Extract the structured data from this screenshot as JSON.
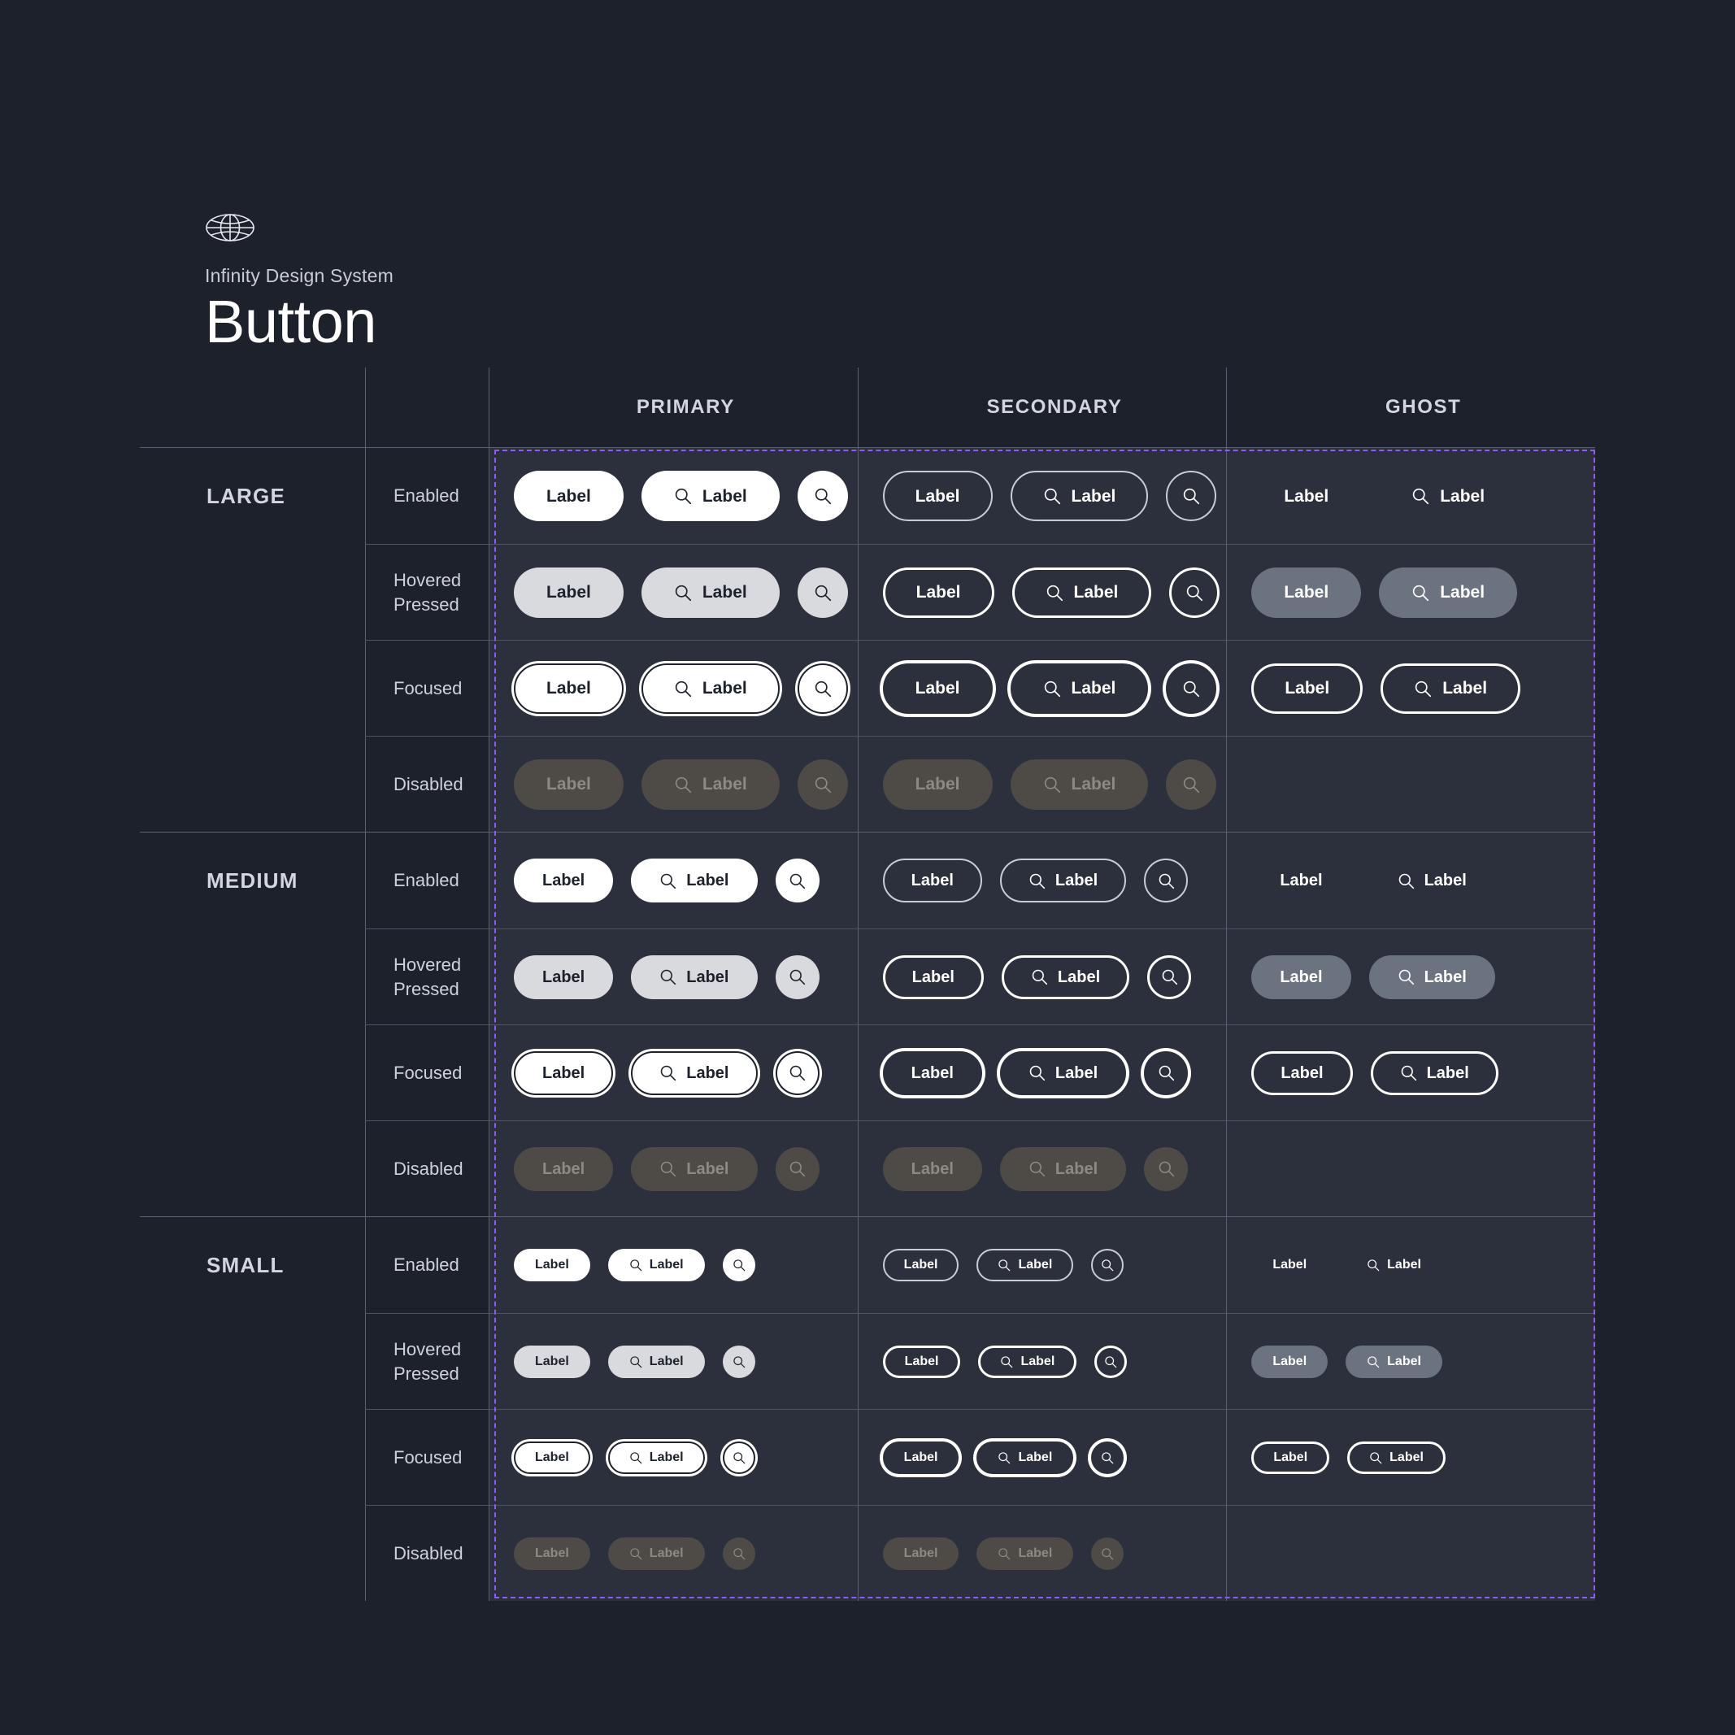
{
  "header": {
    "logo_icon": "globe-icon",
    "eyebrow": "Infinity Design System",
    "title": "Button"
  },
  "matrix": {
    "columns": [
      {
        "key": "primary",
        "label": "PRIMARY"
      },
      {
        "key": "secondary",
        "label": "SECONDARY"
      },
      {
        "key": "ghost",
        "label": "GHOST"
      }
    ],
    "sizes": [
      {
        "key": "large",
        "label": "LARGE"
      },
      {
        "key": "medium",
        "label": "MEDIUM"
      },
      {
        "key": "small",
        "label": "SMALL"
      }
    ],
    "states": [
      {
        "key": "enabled",
        "label": "Enabled"
      },
      {
        "key": "hovered",
        "label": "Hovered\nPressed"
      },
      {
        "key": "focused",
        "label": "Focused"
      },
      {
        "key": "disabled",
        "label": "Disabled"
      }
    ],
    "button_label": "Label",
    "icon": "search-icon",
    "ghost_has_icon_only": false,
    "ghost_has_disabled": false
  },
  "colors": {
    "page_background": "#1c212c",
    "cell_background": "#2b303c",
    "grid_line": "#5b6170",
    "selection_outline": "#8b5cf6",
    "primary_enabled_fill": "#ffffff",
    "primary_hovered_fill": "#d9dadd",
    "disabled_fill": "#4e4a46",
    "disabled_text": "#8d8a86",
    "ghost_hovered_fill": "#6b7280",
    "text_primary": "#ffffff",
    "text_muted": "#cfd2da"
  }
}
